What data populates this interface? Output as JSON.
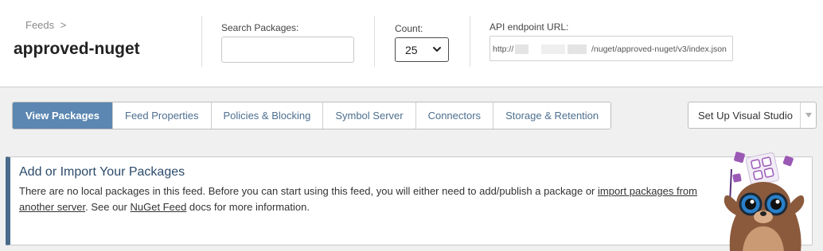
{
  "header": {
    "breadcrumb": "Feeds",
    "breadcrumb_sep": ">",
    "feed_name": "approved-nuget",
    "search": {
      "label": "Search Packages:",
      "value": "",
      "placeholder": ""
    },
    "count": {
      "label": "Count:",
      "value": "25"
    },
    "api": {
      "label": "API endpoint URL:",
      "prefix": "http://",
      "suffix": "/nuget/approved-nuget/v3/index.json"
    }
  },
  "tabs": [
    {
      "label": "View Packages",
      "active": true
    },
    {
      "label": "Feed Properties"
    },
    {
      "label": "Policies & Blocking"
    },
    {
      "label": "Symbol Server"
    },
    {
      "label": "Connectors"
    },
    {
      "label": "Storage & Retention"
    }
  ],
  "setup_button": {
    "label": "Set Up Visual Studio"
  },
  "info": {
    "title": "Add or Import Your Packages",
    "text_1": "There are no local packages in this feed. Before you can start using this feed, you will either need to add/publish a package or ",
    "link_import": "import packages from another server",
    "text_2": ". See our ",
    "link_docs": "NuGet Feed",
    "text_3": " docs for more information."
  },
  "colors": {
    "accent": "#5b87b2",
    "panel_border": "#4a6b8a",
    "mascot_purple": "#9b59b6",
    "mascot_brown": "#8b5a3c"
  }
}
